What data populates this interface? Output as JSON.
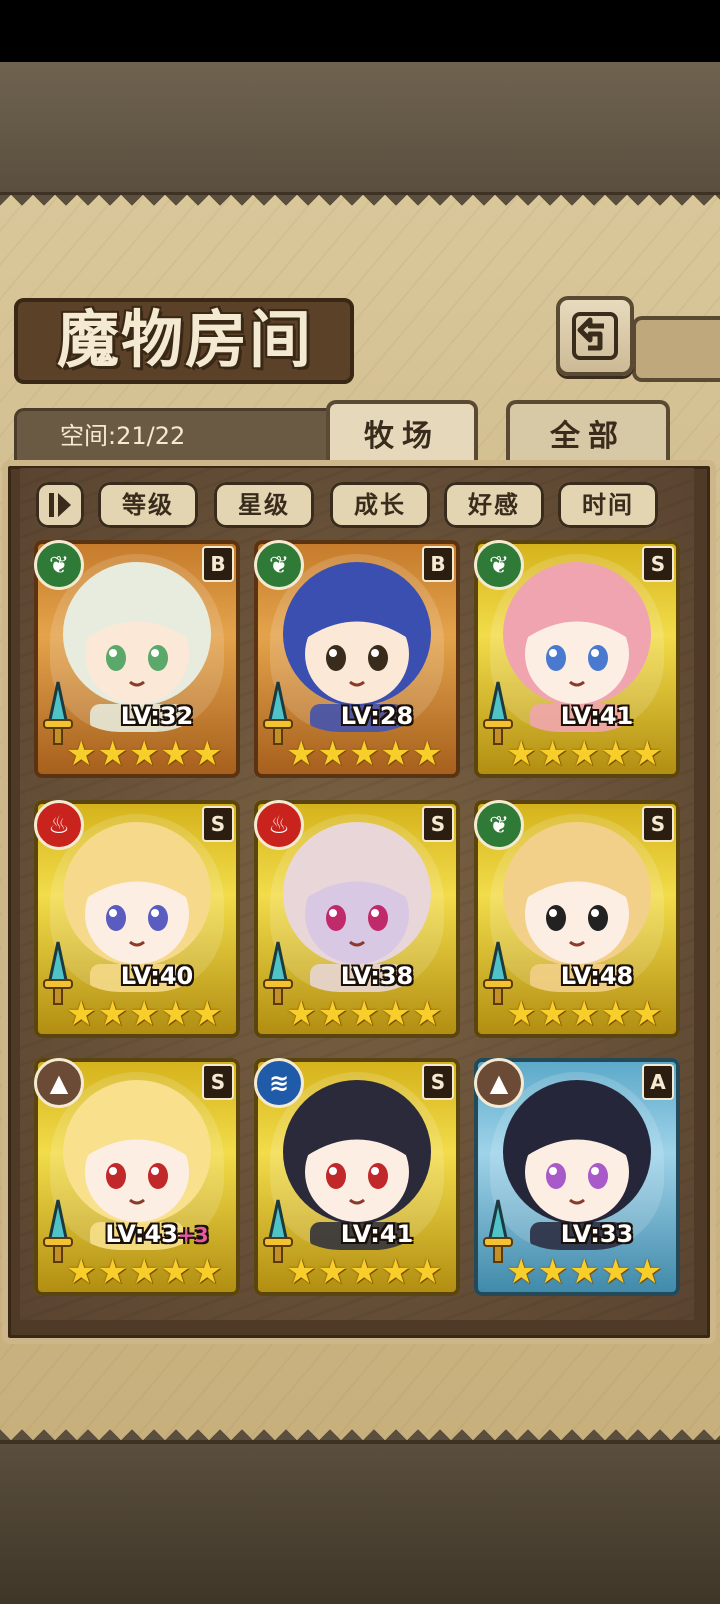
{
  "title": "魔物房间",
  "space_label": "空间:21/22",
  "tabs": [
    {
      "label": "牧场",
      "active": true
    },
    {
      "label": "全部",
      "active": false
    }
  ],
  "filters": [
    "等级",
    "星级",
    "成长",
    "好感",
    "时间"
  ],
  "colors": {
    "grade_B": "#e4a34b",
    "grade_S": "#f2dc4a",
    "grade_A": "#9fd3ea",
    "star": "#f8cf2a",
    "nature": "#2f7a36",
    "fire": "#c8231d",
    "earth": "#6b4a36",
    "water": "#1f5ba8"
  },
  "monsters": [
    {
      "level": "LV:32",
      "bonus": "",
      "grade": "B",
      "element": "nature",
      "element_icon": "leaf-icon",
      "stars": 5,
      "hair": "#e8ecde",
      "skin": "#fbe8d6",
      "eye": "#5aa86a"
    },
    {
      "level": "LV:28",
      "bonus": "",
      "grade": "B",
      "element": "nature",
      "element_icon": "leaf-icon",
      "stars": 5,
      "hair": "#3b4fb0",
      "skin": "#fbe8d6",
      "eye": "#3a2c1c"
    },
    {
      "level": "LV:41",
      "bonus": "",
      "grade": "S",
      "element": "nature",
      "element_icon": "leaf-icon",
      "stars": 5,
      "hair": "#f0a4b0",
      "skin": "#fdeee4",
      "eye": "#4a7ad0"
    },
    {
      "level": "LV:40",
      "bonus": "",
      "grade": "S",
      "element": "fire",
      "element_icon": "flame-icon",
      "stars": 5,
      "hair": "#f6d98a",
      "skin": "#fdeee4",
      "eye": "#5a5cc0"
    },
    {
      "level": "LV:38",
      "bonus": "",
      "grade": "S",
      "element": "fire",
      "element_icon": "flame-icon",
      "stars": 5,
      "hair": "#e8d6d8",
      "skin": "#d9c8e4",
      "eye": "#c02a6a"
    },
    {
      "level": "LV:48",
      "bonus": "",
      "grade": "S",
      "element": "nature",
      "element_icon": "leaf-icon",
      "stars": 5,
      "hair": "#f3d08a",
      "skin": "#fdeee4",
      "eye": "#222222"
    },
    {
      "level": "LV:43",
      "bonus": "+3",
      "grade": "S",
      "element": "earth",
      "element_icon": "mountain-icon",
      "stars": 5,
      "hair": "#f8e08c",
      "skin": "#fdeee4",
      "eye": "#c0282a"
    },
    {
      "level": "LV:41",
      "bonus": "",
      "grade": "S",
      "element": "water",
      "element_icon": "wave-icon",
      "stars": 5,
      "hair": "#2a2a3a",
      "skin": "#fdeee4",
      "eye": "#c0282a"
    },
    {
      "level": "LV:33",
      "bonus": "",
      "grade": "A",
      "element": "earth",
      "element_icon": "mountain-icon",
      "stars": 5,
      "hair": "#26263a",
      "skin": "#fdeee4",
      "eye": "#a85ac8"
    }
  ]
}
